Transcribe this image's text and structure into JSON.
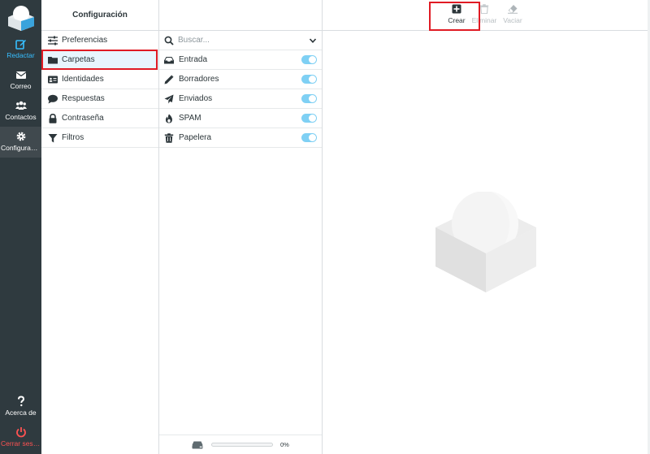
{
  "nav": {
    "items": [
      {
        "label": "Redactar",
        "icon": "compose-icon"
      },
      {
        "label": "Correo",
        "icon": "envelope-icon"
      },
      {
        "label": "Contactos",
        "icon": "users-icon"
      },
      {
        "label": "Configuraci...",
        "icon": "gear-icon"
      }
    ],
    "bottom": [
      {
        "label": "Acerca de",
        "icon": "question-icon"
      },
      {
        "label": "Cerrar sesión",
        "icon": "power-icon"
      }
    ]
  },
  "settings": {
    "title": "Configuración",
    "items": [
      {
        "label": "Preferencias",
        "icon": "sliders-icon"
      },
      {
        "label": "Carpetas",
        "icon": "folder-icon",
        "selected": true
      },
      {
        "label": "Identidades",
        "icon": "id-card-icon"
      },
      {
        "label": "Respuestas",
        "icon": "comment-icon"
      },
      {
        "label": "Contraseña",
        "icon": "lock-icon"
      },
      {
        "label": "Filtros",
        "icon": "filter-icon"
      }
    ]
  },
  "folders": {
    "search_placeholder": "Buscar...",
    "items": [
      {
        "name": "Entrada",
        "icon": "inbox-icon",
        "subscribed": true
      },
      {
        "name": "Borradores",
        "icon": "pencil-icon",
        "subscribed": true
      },
      {
        "name": "Enviados",
        "icon": "paper-plane-icon",
        "subscribed": true
      },
      {
        "name": "SPAM",
        "icon": "fire-icon",
        "subscribed": true
      },
      {
        "name": "Papelera",
        "icon": "trash-icon",
        "subscribed": true
      }
    ],
    "quota": {
      "percent_label": "0%",
      "value": 0
    }
  },
  "toolbar": {
    "create_label": "Crear",
    "delete_label": "Eliminar",
    "empty_label": "Vaciar"
  },
  "colors": {
    "nav_bg": "#2f3a3f",
    "accent": "#37beff",
    "logout": "#ff5252",
    "highlight": "#e01b24",
    "toggle_on": "#7fd0f4"
  }
}
